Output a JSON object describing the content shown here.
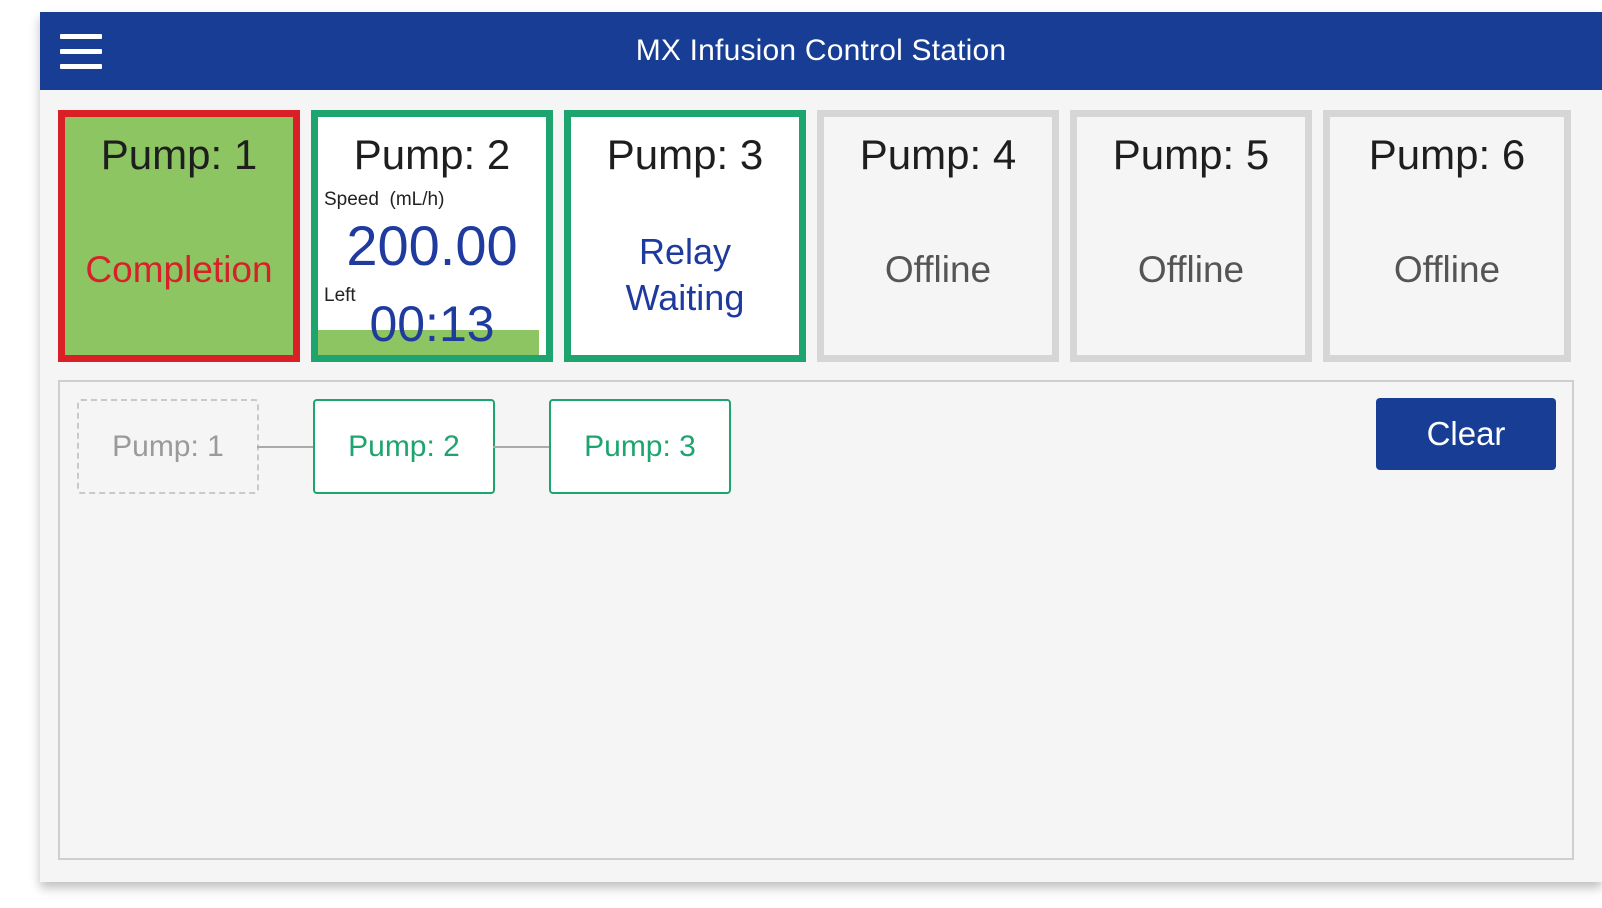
{
  "header": {
    "title": "MX Infusion Control Station",
    "menu_icon": "hamburger-menu-icon",
    "background_color": "#173e94"
  },
  "pumps": [
    {
      "name": "Pump: 1",
      "status": "Completion",
      "border_color": "#da2027",
      "fill_color": "#8dc562"
    },
    {
      "name": "Pump: 2",
      "speed_label": "Speed  (mL/h)",
      "speed_value": "200.00",
      "left_label": "Left",
      "left_value": "00:13",
      "progress_fraction": 0.97,
      "border_color": "#1ea46f"
    },
    {
      "name": "Pump: 3",
      "status_line1": "Relay",
      "status_line2": "Waiting",
      "border_color": "#1ea46f"
    },
    {
      "name": "Pump: 4",
      "status": "Offline"
    },
    {
      "name": "Pump: 5",
      "status": "Offline"
    },
    {
      "name": "Pump: 6",
      "status": "Offline"
    }
  ],
  "relay_chain": {
    "nodes": [
      {
        "label": "Pump: 1",
        "state": "completed"
      },
      {
        "label": "Pump: 2",
        "state": "active"
      },
      {
        "label": "Pump: 3",
        "state": "active"
      }
    ],
    "clear_label": "Clear"
  },
  "colors": {
    "accent_blue": "#173e94",
    "active_green": "#1ea46f",
    "alert_red": "#da2027",
    "completion_fill": "#8dc562"
  }
}
